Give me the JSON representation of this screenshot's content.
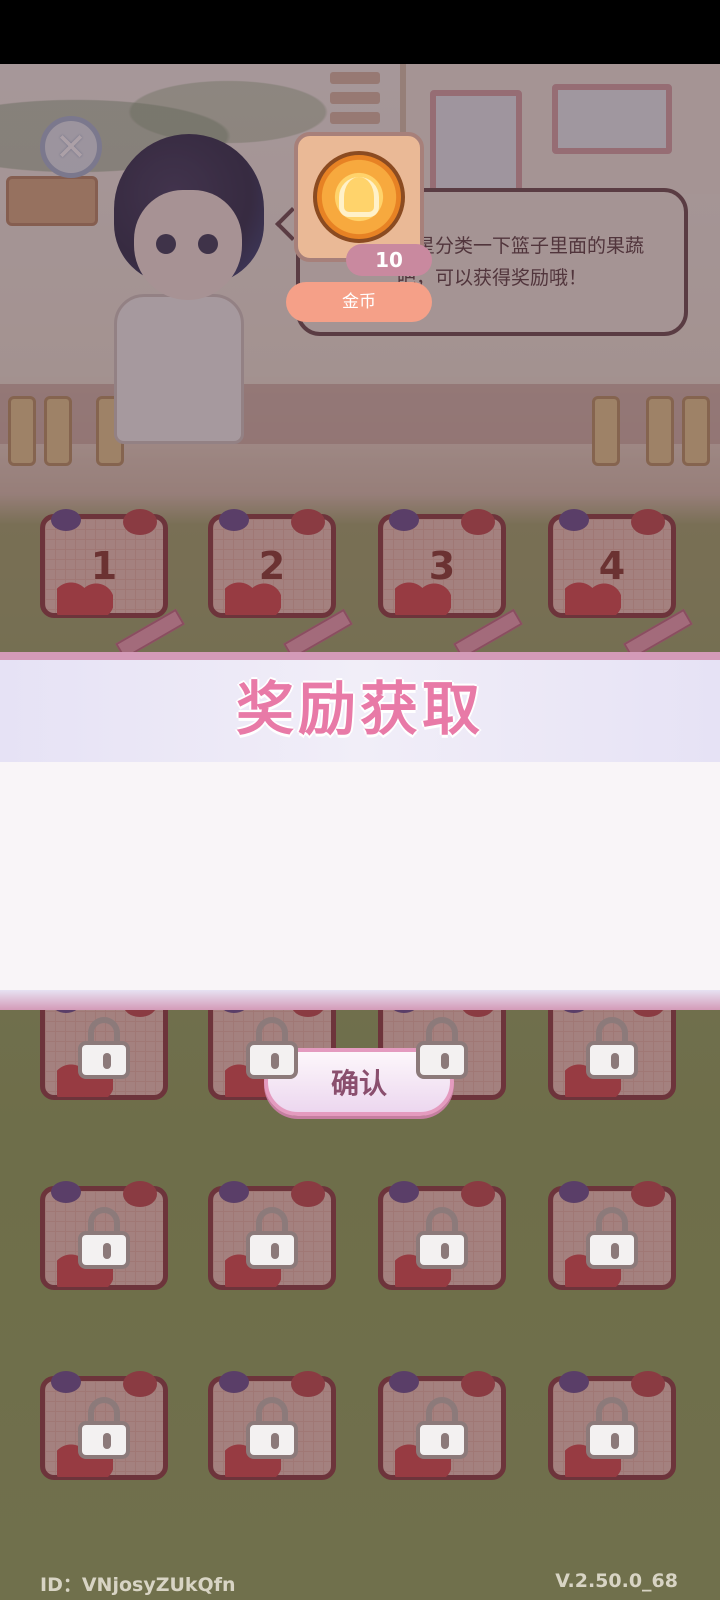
{
  "dialog": {
    "speech": "快来帮茂星分类一下篮子里面的果蔬吧，可以获得奖励哦！",
    "close_icon": "close-icon"
  },
  "baskets": {
    "unlocked": [
      "1",
      "2",
      "3",
      "4"
    ],
    "locked_count": 12,
    "lock_icon": "lock-icon"
  },
  "reward": {
    "title": "奖励获取",
    "item_icon": "coin-icon",
    "count": "10",
    "name": "金币",
    "confirm_label": "确认"
  },
  "footer": {
    "id_text": "ID：VNjosyZUkQfn",
    "version": "V.2.50.0_68"
  },
  "colors": {
    "title_pink": "#e87aa7",
    "basket_border": "#8c3b3b",
    "reward_name_bg": "#f5a088"
  }
}
